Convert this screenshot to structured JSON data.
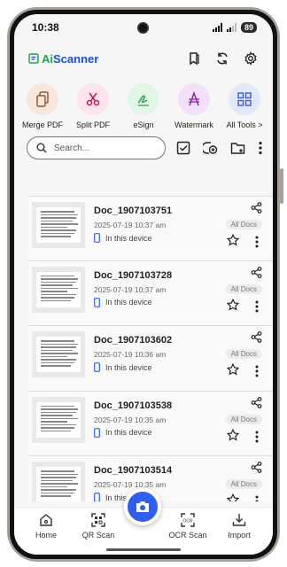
{
  "status": {
    "time": "10:38",
    "battery": "89"
  },
  "header": {
    "app_name_prefix": "Ai",
    "app_name_suffix": "Scanner",
    "icons": [
      "bookmark-icon",
      "sync-icon",
      "settings-gear-icon"
    ]
  },
  "tools": [
    {
      "label": "Merge PDF",
      "icon": "merge-pdf-icon",
      "bg": "#fbe6da",
      "fg": "#8a5a44"
    },
    {
      "label": "Split PDF",
      "icon": "scissors-icon",
      "bg": "#fde3ea",
      "fg": "#c2185b"
    },
    {
      "label": "eSign",
      "icon": "signature-icon",
      "bg": "#e2f6e6",
      "fg": "#2e9e50"
    },
    {
      "label": "Watermark",
      "icon": "watermark-icon",
      "bg": "#f3e1fb",
      "fg": "#8e24aa"
    },
    {
      "label": "All Tools >",
      "icon": "grid-icon",
      "bg": "#e1e9fb",
      "fg": "#3b5ad8"
    }
  ],
  "search": {
    "placeholder": "Search..."
  },
  "documents": [
    {
      "title": "Doc_1907103751",
      "date": "2025-07-19 10:37 am",
      "location": "In this device",
      "tag": "All Docs"
    },
    {
      "title": "Doc_1907103728",
      "date": "2025-07-19 10:37 am",
      "location": "In this device",
      "tag": "All Docs"
    },
    {
      "title": "Doc_1907103602",
      "date": "2025-07-19 10:36 am",
      "location": "In this device",
      "tag": "All Docs"
    },
    {
      "title": "Doc_1907103538",
      "date": "2025-07-19 10:35 am",
      "location": "In this device",
      "tag": "All Docs"
    },
    {
      "title": "Doc_1907103514",
      "date": "2025-07-19 10:35 am",
      "location": "In this device",
      "tag": "All Docs"
    }
  ],
  "nav": {
    "home": "Home",
    "qr_scan": "QR Scan",
    "ocr_scan": "OCR Scan",
    "import": "Import"
  },
  "colors": {
    "accent": "#2f5ef1",
    "logo_green": "#1ba45b",
    "logo_blue": "#1d4ed8"
  }
}
